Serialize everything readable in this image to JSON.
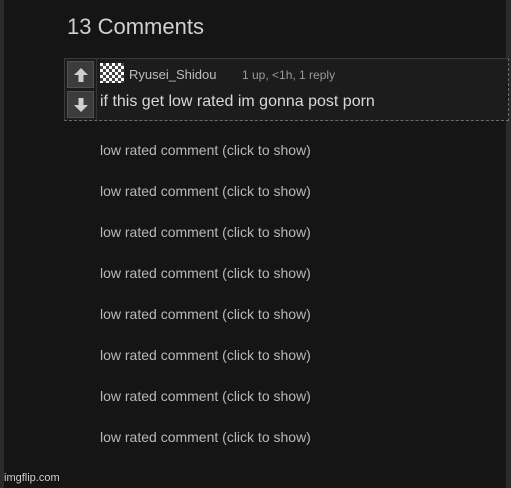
{
  "header": {
    "title": "13 Comments"
  },
  "comment": {
    "username": "Ryusei_Shidou",
    "meta": "1 up, <1h, 1 reply",
    "text": "if this get low rated im gonna post porn",
    "upvote_icon": "arrow-up-icon",
    "downvote_icon": "arrow-down-icon"
  },
  "low_rated": [
    "low rated comment (click to show)",
    "low rated comment (click to show)",
    "low rated comment (click to show)",
    "low rated comment (click to show)",
    "low rated comment (click to show)",
    "low rated comment (click to show)",
    "low rated comment (click to show)",
    "low rated comment (click to show)"
  ],
  "watermark": "imgflip.com",
  "colors": {
    "background": "#151515",
    "text": "#c8c8c8",
    "vote_button": "#3c3c3c"
  }
}
